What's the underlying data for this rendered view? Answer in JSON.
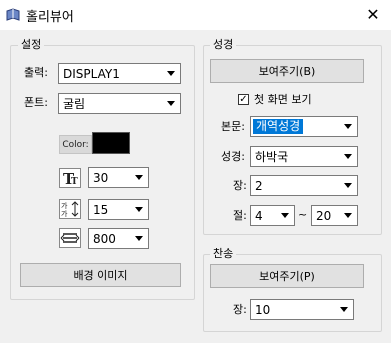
{
  "window": {
    "title": "홀리뷰어",
    "close_label": "✕"
  },
  "settings": {
    "group_title": "설정",
    "output_label": "출력:",
    "output_value": "DISPLAY1",
    "font_label": "폰트:",
    "font_value": "굴림",
    "color_label": "Color:",
    "color_value": "#000000",
    "font_size_value": "30",
    "line_spacing_value": "15",
    "width_value": "800",
    "bg_image_button": "배경 이미지"
  },
  "scripture": {
    "group_title": "성경",
    "show_button": "보여주기(B)",
    "first_screen_checkbox_label": "첫 화면 보기",
    "first_screen_checked": true,
    "version_label": "본문:",
    "version_value": "개역성경",
    "book_label": "성경:",
    "book_value": "하박국",
    "chapter_label": "장:",
    "chapter_value": "2",
    "verse_label": "절:",
    "verse_from": "4",
    "verse_separator": "~",
    "verse_to": "20"
  },
  "hymn": {
    "group_title": "찬송",
    "show_button": "보여주기(P)",
    "chapter_label": "장:",
    "chapter_value": "10"
  }
}
